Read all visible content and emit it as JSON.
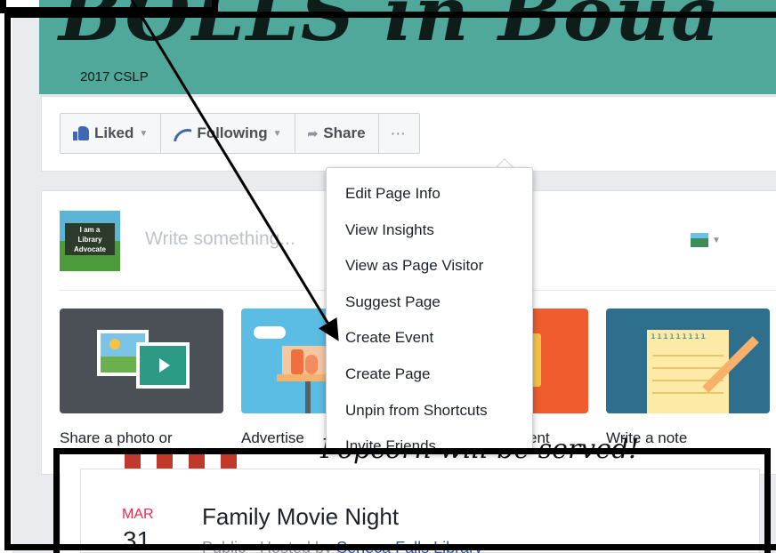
{
  "cover": {
    "title_partial": "BOLLS in Boua",
    "caption": "2017 CSLP"
  },
  "actions": {
    "liked": "Liked",
    "following": "Following",
    "share": "Share",
    "more": "···"
  },
  "composer": {
    "placeholder": "Write something...",
    "avatar_text": "I am a Library Advocate"
  },
  "menu": {
    "items": [
      "Edit Page Info",
      "View Insights",
      "View as Page Visitor",
      "Suggest Page",
      "Create Event",
      "Create Page",
      "Unpin from Shortcuts",
      "Invite Friends"
    ]
  },
  "tiles": {
    "photo": "Share a photo or",
    "advertise": "Advertise",
    "event": "ent",
    "note": "Write a note"
  },
  "event": {
    "banner_text": "Popcorn will be served!",
    "month": "MAR",
    "day": "31",
    "title": "Family Movie Night",
    "meta_prefix": "Public · Hosted by ",
    "host": "Seneca Falls Library"
  },
  "colors": {
    "brand_blue": "#4267b2",
    "link_blue": "#365899",
    "date_red": "#f02849",
    "cover_teal": "#4fa89a",
    "annotation_black": "#000000"
  }
}
